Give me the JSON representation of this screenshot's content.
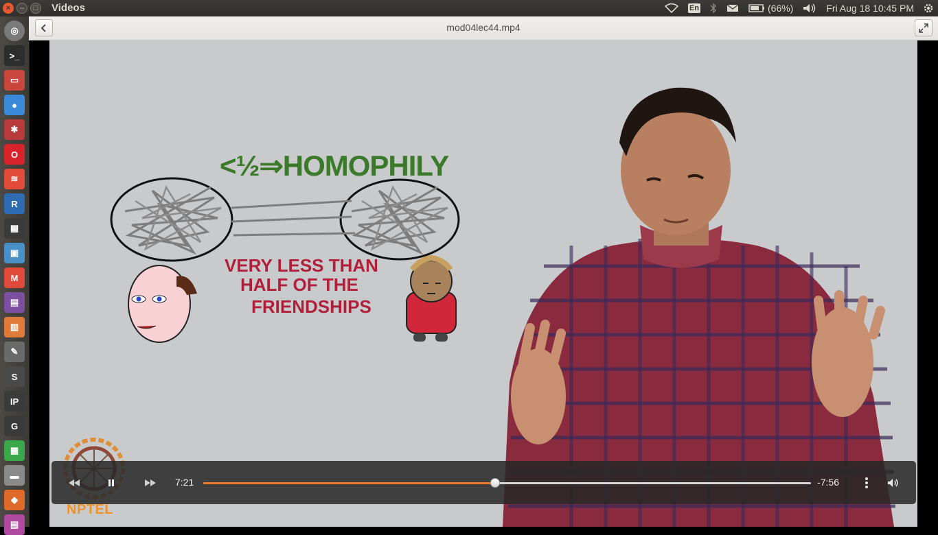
{
  "top_panel": {
    "app_title": "Videos",
    "keyboard_layout": "En",
    "battery": "(66%)",
    "clock": "Fri Aug 18 10:45 PM",
    "icons": [
      "wifi-icon",
      "keyboard-layout-icon",
      "bluetooth-icon",
      "mail-icon",
      "battery-icon",
      "volume-icon",
      "settings-gear-icon"
    ]
  },
  "launcher": {
    "items": [
      {
        "name": "ubuntu-dash",
        "color": "#7a7a7a",
        "glyph": "◎"
      },
      {
        "name": "terminal",
        "color": "#2d2d2d",
        "glyph": ">_"
      },
      {
        "name": "files-archive",
        "color": "#c9463d",
        "glyph": "▭"
      },
      {
        "name": "chrome",
        "color": "#3b8ad9",
        "glyph": "●"
      },
      {
        "name": "settings-tool",
        "color": "#b83a3a",
        "glyph": "✱"
      },
      {
        "name": "opera",
        "color": "#d8232a",
        "glyph": "O"
      },
      {
        "name": "document-viewer",
        "color": "#e24b3a",
        "glyph": "≋"
      },
      {
        "name": "r-language",
        "color": "#2d6bb3",
        "glyph": "R"
      },
      {
        "name": "video-editor",
        "color": "#3a3a3a",
        "glyph": "▦"
      },
      {
        "name": "image-viewer",
        "color": "#4a90c8",
        "glyph": "▣"
      },
      {
        "name": "gmail",
        "color": "#e04a3a",
        "glyph": "M"
      },
      {
        "name": "media-player",
        "color": "#7d4fa0",
        "glyph": "▤"
      },
      {
        "name": "presentation",
        "color": "#e07a3a",
        "glyph": "▥"
      },
      {
        "name": "text-editor",
        "color": "#6a6a6a",
        "glyph": "✎"
      },
      {
        "name": "sublime-text",
        "color": "#4a4a4a",
        "glyph": "S"
      },
      {
        "name": "ipython",
        "color": "#3a3a3a",
        "glyph": "IP"
      },
      {
        "name": "gnuplot",
        "color": "#3a3a3a",
        "glyph": "G"
      },
      {
        "name": "spreadsheet",
        "color": "#3aa84a",
        "glyph": "▦"
      },
      {
        "name": "disk-drive",
        "color": "#8a8a8a",
        "glyph": "▬"
      },
      {
        "name": "software-center",
        "color": "#e06a2a",
        "glyph": "◆"
      },
      {
        "name": "workspaces",
        "color": "#b04aa0",
        "glyph": "▤"
      }
    ]
  },
  "header": {
    "title": "mod04lec44.mp4",
    "back_icon": "chevron-left-icon",
    "expand_icon": "fullscreen-icon"
  },
  "video": {
    "slide_title": "<½⇒HOMOPHILY",
    "slide_caption_lines": [
      "VERY LESS THAN",
      "HALF OF THE",
      "FRIENDSHIPS"
    ],
    "watermark": "NPTEL"
  },
  "player": {
    "elapsed": "7:21",
    "remaining": "-7:56",
    "progress_fraction": 0.48,
    "accent_color": "#f0782a"
  }
}
